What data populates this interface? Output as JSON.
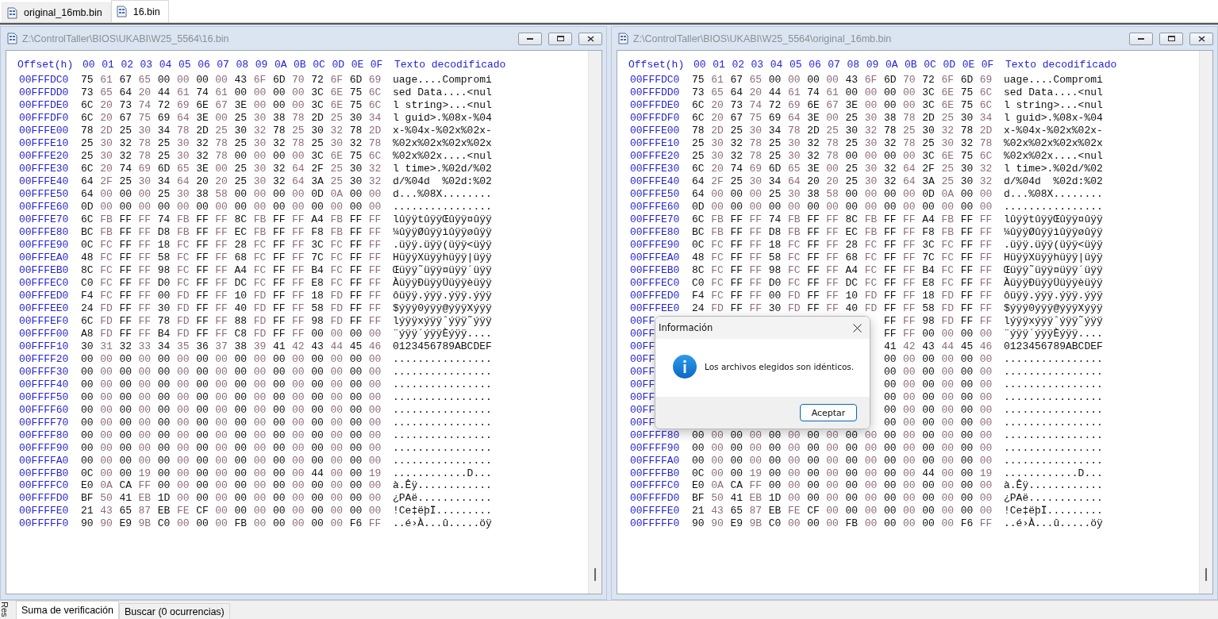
{
  "file_tabs": [
    {
      "label": "original_16mb.bin",
      "selected": false
    },
    {
      "label": "16.bin",
      "selected": true
    }
  ],
  "panels": [
    {
      "title": "Z:\\ControlTaller\\BIOS\\UKABI\\W25_5564\\16.bin",
      "header": {
        "offset_label": "Offset(h)",
        "columns": [
          "00",
          "01",
          "02",
          "03",
          "04",
          "05",
          "06",
          "07",
          "08",
          "09",
          "0A",
          "0B",
          "0C",
          "0D",
          "0E",
          "0F"
        ],
        "text_label": "Texto decodificado"
      },
      "rows": [
        {
          "offset": "00FFFDC0",
          "hex": "75 61 67 65 00 00 00 00 43 6F 6D 70 72 6F 6D 69",
          "text": "uage....Compromi"
        },
        {
          "offset": "00FFFDD0",
          "hex": "73 65 64 20 44 61 74 61 00 00 00 00 3C 6E 75 6C",
          "text": "sed Data....<nul"
        },
        {
          "offset": "00FFFDE0",
          "hex": "6C 20 73 74 72 69 6E 67 3E 00 00 00 3C 6E 75 6C",
          "text": "l string>...<nul"
        },
        {
          "offset": "00FFFDF0",
          "hex": "6C 20 67 75 69 64 3E 00 25 30 38 78 2D 25 30 34",
          "text": "l guid>.%08x-%04"
        },
        {
          "offset": "00FFFE00",
          "hex": "78 2D 25 30 34 78 2D 25 30 32 78 25 30 32 78 2D",
          "text": "x-%04x-%02x%02x-"
        },
        {
          "offset": "00FFFE10",
          "hex": "25 30 32 78 25 30 32 78 25 30 32 78 25 30 32 78",
          "text": "%02x%02x%02x%02x"
        },
        {
          "offset": "00FFFE20",
          "hex": "25 30 32 78 25 30 32 78 00 00 00 00 3C 6E 75 6C",
          "text": "%02x%02x....<nul"
        },
        {
          "offset": "00FFFE30",
          "hex": "6C 20 74 69 6D 65 3E 00 25 30 32 64 2F 25 30 32",
          "text": "l time>.%02d/%02"
        },
        {
          "offset": "00FFFE40",
          "hex": "64 2F 25 30 34 64 20 20 25 30 32 64 3A 25 30 32",
          "text": "d/%04d  %02d:%02"
        },
        {
          "offset": "00FFFE50",
          "hex": "64 00 00 00 25 30 38 58 00 00 00 00 0D 0A 00 00",
          "text": "d...%08X........"
        },
        {
          "offset": "00FFFE60",
          "hex": "0D 00 00 00 00 00 00 00 00 00 00 00 00 00 00 00",
          "text": "................"
        },
        {
          "offset": "00FFFE70",
          "hex": "6C FB FF FF 74 FB FF FF 8C FB FF FF A4 FB FF FF",
          "text": "lûÿÿtûÿÿŒûÿÿ¤ûÿÿ"
        },
        {
          "offset": "00FFFE80",
          "hex": "BC FB FF FF D8 FB FF FF EC FB FF FF F8 FB FF FF",
          "text": "¼ûÿÿØûÿÿìûÿÿøûÿÿ"
        },
        {
          "offset": "00FFFE90",
          "hex": "0C FC FF FF 18 FC FF FF 28 FC FF FF 3C FC FF FF",
          "text": ".üÿÿ.üÿÿ(üÿÿ<üÿÿ"
        },
        {
          "offset": "00FFFEA0",
          "hex": "48 FC FF FF 58 FC FF FF 68 FC FF FF 7C FC FF FF",
          "text": "HüÿÿXüÿÿhüÿÿ|üÿÿ"
        },
        {
          "offset": "00FFFEB0",
          "hex": "8C FC FF FF 98 FC FF FF A4 FC FF FF B4 FC FF FF",
          "text": "Œüÿÿ˜üÿÿ¤üÿÿ´üÿÿ"
        },
        {
          "offset": "00FFFEC0",
          "hex": "C0 FC FF FF D0 FC FF FF DC FC FF FF E8 FC FF FF",
          "text": "ÀüÿÿÐüÿÿÜüÿÿèüÿÿ"
        },
        {
          "offset": "00FFFED0",
          "hex": "F4 FC FF FF 00 FD FF FF 10 FD FF FF 18 FD FF FF",
          "text": "ôüÿÿ.ýÿÿ.ýÿÿ.ýÿÿ"
        },
        {
          "offset": "00FFFEE0",
          "hex": "24 FD FF FF 30 FD FF FF 40 FD FF FF 58 FD FF FF",
          "text": "$ýÿÿ0ýÿÿ@ýÿÿXýÿÿ"
        },
        {
          "offset": "00FFFEF0",
          "hex": "6C FD FF FF 78 FD FF FF 88 FD FF FF 98 FD FF FF",
          "text": "lýÿÿxýÿÿˆýÿÿ˜ýÿÿ"
        },
        {
          "offset": "00FFFF00",
          "hex": "A8 FD FF FF B4 FD FF FF C8 FD FF FF 00 00 00 00",
          "text": "¨ýÿÿ´ýÿÿÈýÿÿ...."
        },
        {
          "offset": "00FFFF10",
          "hex": "30 31 32 33 34 35 36 37 38 39 41 42 43 44 45 46",
          "text": "0123456789ABCDEF"
        },
        {
          "offset": "00FFFF20",
          "hex": "00 00 00 00 00 00 00 00 00 00 00 00 00 00 00 00",
          "text": "................"
        },
        {
          "offset": "00FFFF30",
          "hex": "00 00 00 00 00 00 00 00 00 00 00 00 00 00 00 00",
          "text": "................"
        },
        {
          "offset": "00FFFF40",
          "hex": "00 00 00 00 00 00 00 00 00 00 00 00 00 00 00 00",
          "text": "................"
        },
        {
          "offset": "00FFFF50",
          "hex": "00 00 00 00 00 00 00 00 00 00 00 00 00 00 00 00",
          "text": "................"
        },
        {
          "offset": "00FFFF60",
          "hex": "00 00 00 00 00 00 00 00 00 00 00 00 00 00 00 00",
          "text": "................"
        },
        {
          "offset": "00FFFF70",
          "hex": "00 00 00 00 00 00 00 00 00 00 00 00 00 00 00 00",
          "text": "................"
        },
        {
          "offset": "00FFFF80",
          "hex": "00 00 00 00 00 00 00 00 00 00 00 00 00 00 00 00",
          "text": "................"
        },
        {
          "offset": "00FFFF90",
          "hex": "00 00 00 00 00 00 00 00 00 00 00 00 00 00 00 00",
          "text": "................"
        },
        {
          "offset": "00FFFFA0",
          "hex": "00 00 00 00 00 00 00 00 00 00 00 00 00 00 00 00",
          "text": "................"
        },
        {
          "offset": "00FFFFB0",
          "hex": "0C 00 00 19 00 00 00 00 00 00 00 00 44 00 00 19",
          "text": "............D..."
        },
        {
          "offset": "00FFFFC0",
          "hex": "E0 0A CA FF 00 00 00 00 00 00 00 00 00 00 00 00",
          "text": "à.Êÿ............"
        },
        {
          "offset": "00FFFFD0",
          "hex": "BF 50 41 EB 1D 00 00 00 00 00 00 00 00 00 00 00",
          "text": "¿PAë............"
        },
        {
          "offset": "00FFFFE0",
          "hex": "21 43 65 87 EB FE CF 00 00 00 00 00 00 00 00 00",
          "text": "!Ce‡ëþÏ........."
        },
        {
          "offset": "00FFFFF0",
          "hex": "90 90 E9 9B C0 00 00 00 FB 00 00 00 00 00 F6 FF",
          "text": "..é›À...û.....öÿ"
        }
      ]
    },
    {
      "title": "Z:\\ControlTaller\\BIOS\\UKABI\\W25_5564\\original_16mb.bin",
      "header": {
        "offset_label": "Offset(h)",
        "columns": [
          "00",
          "01",
          "02",
          "03",
          "04",
          "05",
          "06",
          "07",
          "08",
          "09",
          "0A",
          "0B",
          "0C",
          "0D",
          "0E",
          "0F"
        ],
        "text_label": "Texto decodificado"
      },
      "rows": [
        {
          "offset": "00FFFDC0",
          "hex": "75 61 67 65 00 00 00 00 43 6F 6D 70 72 6F 6D 69",
          "text": "uage....Compromi"
        },
        {
          "offset": "00FFFDD0",
          "hex": "73 65 64 20 44 61 74 61 00 00 00 00 3C 6E 75 6C",
          "text": "sed Data....<nul"
        },
        {
          "offset": "00FFFDE0",
          "hex": "6C 20 73 74 72 69 6E 67 3E 00 00 00 3C 6E 75 6C",
          "text": "l string>...<nul"
        },
        {
          "offset": "00FFFDF0",
          "hex": "6C 20 67 75 69 64 3E 00 25 30 38 78 2D 25 30 34",
          "text": "l guid>.%08x-%04"
        },
        {
          "offset": "00FFFE00",
          "hex": "78 2D 25 30 34 78 2D 25 30 32 78 25 30 32 78 2D",
          "text": "x-%04x-%02x%02x-"
        },
        {
          "offset": "00FFFE10",
          "hex": "25 30 32 78 25 30 32 78 25 30 32 78 25 30 32 78",
          "text": "%02x%02x%02x%02x"
        },
        {
          "offset": "00FFFE20",
          "hex": "25 30 32 78 25 30 32 78 00 00 00 00 3C 6E 75 6C",
          "text": "%02x%02x....<nul"
        },
        {
          "offset": "00FFFE30",
          "hex": "6C 20 74 69 6D 65 3E 00 25 30 32 64 2F 25 30 32",
          "text": "l time>.%02d/%02"
        },
        {
          "offset": "00FFFE40",
          "hex": "64 2F 25 30 34 64 20 20 25 30 32 64 3A 25 30 32",
          "text": "d/%04d  %02d:%02"
        },
        {
          "offset": "00FFFE50",
          "hex": "64 00 00 00 25 30 38 58 00 00 00 00 0D 0A 00 00",
          "text": "d...%08X........"
        },
        {
          "offset": "00FFFE60",
          "hex": "0D 00 00 00 00 00 00 00 00 00 00 00 00 00 00 00",
          "text": "................"
        },
        {
          "offset": "00FFFE70",
          "hex": "6C FB FF FF 74 FB FF FF 8C FB FF FF A4 FB FF FF",
          "text": "lûÿÿtûÿÿŒûÿÿ¤ûÿÿ"
        },
        {
          "offset": "00FFFE80",
          "hex": "BC FB FF FF D8 FB FF FF EC FB FF FF F8 FB FF FF",
          "text": "¼ûÿÿØûÿÿìûÿÿøûÿÿ"
        },
        {
          "offset": "00FFFE90",
          "hex": "0C FC FF FF 18 FC FF FF 28 FC FF FF 3C FC FF FF",
          "text": ".üÿÿ.üÿÿ(üÿÿ<üÿÿ"
        },
        {
          "offset": "00FFFEA0",
          "hex": "48 FC FF FF 58 FC FF FF 68 FC FF FF 7C FC FF FF",
          "text": "HüÿÿXüÿÿhüÿÿ|üÿÿ"
        },
        {
          "offset": "00FFFEB0",
          "hex": "8C FC FF FF 98 FC FF FF A4 FC FF FF B4 FC FF FF",
          "text": "Œüÿÿ˜üÿÿ¤üÿÿ´üÿÿ"
        },
        {
          "offset": "00FFFEC0",
          "hex": "C0 FC FF FF D0 FC FF FF DC FC FF FF E8 FC FF FF",
          "text": "ÀüÿÿÐüÿÿÜüÿÿèüÿÿ"
        },
        {
          "offset": "00FFFED0",
          "hex": "F4 FC FF FF 00 FD FF FF 10 FD FF FF 18 FD FF FF",
          "text": "ôüÿÿ.ýÿÿ.ýÿÿ.ýÿÿ"
        },
        {
          "offset": "00FFFEE0",
          "hex": "24 FD FF FF 30 FD FF FF 40 FD FF FF 58 FD FF FF",
          "text": "$ýÿÿ0ýÿÿ@ýÿÿXýÿÿ"
        },
        {
          "offset": "00FF",
          "hex": "FF FF 98 FD FF FF",
          "text": "lýÿÿxýÿÿˆýÿÿ˜ýÿÿ"
        },
        {
          "offset": "00FF",
          "hex": "FF FF 00 00 00 00",
          "text": "¨ýÿÿ´ýÿÿÈýÿÿ...."
        },
        {
          "offset": "00FF",
          "hex": "41 42 43 44 45 46",
          "text": "0123456789ABCDEF"
        },
        {
          "offset": "00FF",
          "hex": "00 00 00 00 00 00",
          "text": "................"
        },
        {
          "offset": "00FF",
          "hex": "00 00 00 00 00 00",
          "text": "................"
        },
        {
          "offset": "00FF",
          "hex": "00 00 00 00 00 00",
          "text": "................"
        },
        {
          "offset": "00FF",
          "hex": "00 00 00 00 00 00",
          "text": "................"
        },
        {
          "offset": "00FF",
          "hex": "00 00 00 00 00 00",
          "text": "................"
        },
        {
          "offset": "00FF",
          "hex": "00 00 00 00 00 00",
          "text": "................"
        },
        {
          "offset": "00FFFF80",
          "hex": "00 00 00 00 00 00 00 00 00 00 00 00 00 00 00 00",
          "text": "................"
        },
        {
          "offset": "00FFFF90",
          "hex": "00 00 00 00 00 00 00 00 00 00 00 00 00 00 00 00",
          "text": "................"
        },
        {
          "offset": "00FFFFA0",
          "hex": "00 00 00 00 00 00 00 00 00 00 00 00 00 00 00 00",
          "text": "................"
        },
        {
          "offset": "00FFFFB0",
          "hex": "0C 00 00 19 00 00 00 00 00 00 00 00 44 00 00 19",
          "text": "............D..."
        },
        {
          "offset": "00FFFFC0",
          "hex": "E0 0A CA FF 00 00 00 00 00 00 00 00 00 00 00 00",
          "text": "à.Êÿ............"
        },
        {
          "offset": "00FFFFD0",
          "hex": "BF 50 41 EB 1D 00 00 00 00 00 00 00 00 00 00 00",
          "text": "¿PAë............"
        },
        {
          "offset": "00FFFFE0",
          "hex": "21 43 65 87 EB FE CF 00 00 00 00 00 00 00 00 00",
          "text": "!Ce‡ëþÏ........."
        },
        {
          "offset": "00FFFFF0",
          "hex": "90 90 E9 9B C0 00 00 00 FB 00 00 00 00 00 F6 FF",
          "text": "..é›À...û.....öÿ"
        }
      ]
    }
  ],
  "dialog": {
    "title": "Información",
    "message": "Los archivos elegidos son idénticos.",
    "button": "Aceptar"
  },
  "side_label": "Res",
  "bottom_tabs": [
    {
      "label": "Suma de verificación",
      "selected": true
    },
    {
      "label": "Buscar (0 ocurrencias)",
      "selected": false
    }
  ]
}
